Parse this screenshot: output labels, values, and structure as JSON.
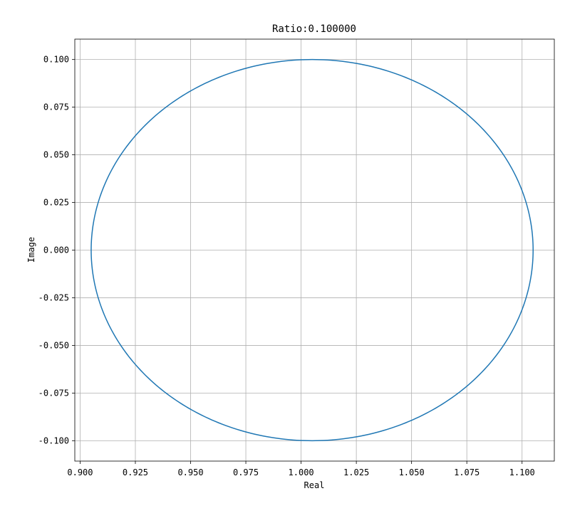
{
  "chart_data": {
    "type": "line",
    "title": "Ratio:0.100000",
    "xlabel": "Real",
    "ylabel": "Image",
    "xlim": [
      0.8976,
      1.1146
    ],
    "ylim": [
      -0.1107,
      0.1107
    ],
    "grid": true,
    "colors": {
      "line": "#1f77b4",
      "grid": "#b0b0b0",
      "axes": "#000000"
    },
    "x_ticks": [
      "0.900",
      "0.925",
      "0.950",
      "0.975",
      "1.000",
      "1.025",
      "1.050",
      "1.075",
      "1.100"
    ],
    "y_ticks": [
      "0.100",
      "0.075",
      "0.050",
      "0.025",
      "0.000",
      "-0.025",
      "-0.050",
      "-0.075",
      "-0.100"
    ],
    "series": [
      {
        "curve": "ellipse",
        "center": [
          1.005,
          0.0
        ],
        "semi_axes": [
          0.1,
          0.1
        ],
        "x_range": [
          0.905,
          1.105
        ],
        "y_range": [
          -0.1,
          0.1
        ]
      }
    ]
  }
}
